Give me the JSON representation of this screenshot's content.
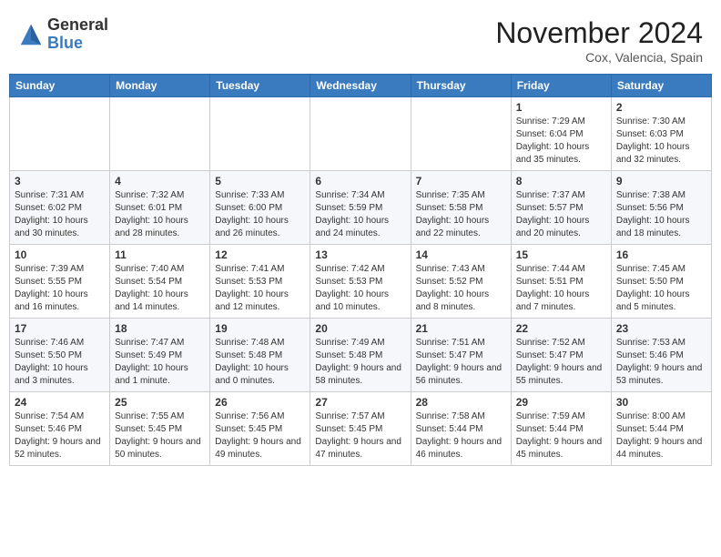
{
  "header": {
    "logo_general": "General",
    "logo_blue": "Blue",
    "month_title": "November 2024",
    "location": "Cox, Valencia, Spain"
  },
  "weekdays": [
    "Sunday",
    "Monday",
    "Tuesday",
    "Wednesday",
    "Thursday",
    "Friday",
    "Saturday"
  ],
  "weeks": [
    [
      {
        "day": "",
        "sunrise": "",
        "sunset": "",
        "daylight": ""
      },
      {
        "day": "",
        "sunrise": "",
        "sunset": "",
        "daylight": ""
      },
      {
        "day": "",
        "sunrise": "",
        "sunset": "",
        "daylight": ""
      },
      {
        "day": "",
        "sunrise": "",
        "sunset": "",
        "daylight": ""
      },
      {
        "day": "",
        "sunrise": "",
        "sunset": "",
        "daylight": ""
      },
      {
        "day": "1",
        "sunrise": "Sunrise: 7:29 AM",
        "sunset": "Sunset: 6:04 PM",
        "daylight": "Daylight: 10 hours and 35 minutes."
      },
      {
        "day": "2",
        "sunrise": "Sunrise: 7:30 AM",
        "sunset": "Sunset: 6:03 PM",
        "daylight": "Daylight: 10 hours and 32 minutes."
      }
    ],
    [
      {
        "day": "3",
        "sunrise": "Sunrise: 7:31 AM",
        "sunset": "Sunset: 6:02 PM",
        "daylight": "Daylight: 10 hours and 30 minutes."
      },
      {
        "day": "4",
        "sunrise": "Sunrise: 7:32 AM",
        "sunset": "Sunset: 6:01 PM",
        "daylight": "Daylight: 10 hours and 28 minutes."
      },
      {
        "day": "5",
        "sunrise": "Sunrise: 7:33 AM",
        "sunset": "Sunset: 6:00 PM",
        "daylight": "Daylight: 10 hours and 26 minutes."
      },
      {
        "day": "6",
        "sunrise": "Sunrise: 7:34 AM",
        "sunset": "Sunset: 5:59 PM",
        "daylight": "Daylight: 10 hours and 24 minutes."
      },
      {
        "day": "7",
        "sunrise": "Sunrise: 7:35 AM",
        "sunset": "Sunset: 5:58 PM",
        "daylight": "Daylight: 10 hours and 22 minutes."
      },
      {
        "day": "8",
        "sunrise": "Sunrise: 7:37 AM",
        "sunset": "Sunset: 5:57 PM",
        "daylight": "Daylight: 10 hours and 20 minutes."
      },
      {
        "day": "9",
        "sunrise": "Sunrise: 7:38 AM",
        "sunset": "Sunset: 5:56 PM",
        "daylight": "Daylight: 10 hours and 18 minutes."
      }
    ],
    [
      {
        "day": "10",
        "sunrise": "Sunrise: 7:39 AM",
        "sunset": "Sunset: 5:55 PM",
        "daylight": "Daylight: 10 hours and 16 minutes."
      },
      {
        "day": "11",
        "sunrise": "Sunrise: 7:40 AM",
        "sunset": "Sunset: 5:54 PM",
        "daylight": "Daylight: 10 hours and 14 minutes."
      },
      {
        "day": "12",
        "sunrise": "Sunrise: 7:41 AM",
        "sunset": "Sunset: 5:53 PM",
        "daylight": "Daylight: 10 hours and 12 minutes."
      },
      {
        "day": "13",
        "sunrise": "Sunrise: 7:42 AM",
        "sunset": "Sunset: 5:53 PM",
        "daylight": "Daylight: 10 hours and 10 minutes."
      },
      {
        "day": "14",
        "sunrise": "Sunrise: 7:43 AM",
        "sunset": "Sunset: 5:52 PM",
        "daylight": "Daylight: 10 hours and 8 minutes."
      },
      {
        "day": "15",
        "sunrise": "Sunrise: 7:44 AM",
        "sunset": "Sunset: 5:51 PM",
        "daylight": "Daylight: 10 hours and 7 minutes."
      },
      {
        "day": "16",
        "sunrise": "Sunrise: 7:45 AM",
        "sunset": "Sunset: 5:50 PM",
        "daylight": "Daylight: 10 hours and 5 minutes."
      }
    ],
    [
      {
        "day": "17",
        "sunrise": "Sunrise: 7:46 AM",
        "sunset": "Sunset: 5:50 PM",
        "daylight": "Daylight: 10 hours and 3 minutes."
      },
      {
        "day": "18",
        "sunrise": "Sunrise: 7:47 AM",
        "sunset": "Sunset: 5:49 PM",
        "daylight": "Daylight: 10 hours and 1 minute."
      },
      {
        "day": "19",
        "sunrise": "Sunrise: 7:48 AM",
        "sunset": "Sunset: 5:48 PM",
        "daylight": "Daylight: 10 hours and 0 minutes."
      },
      {
        "day": "20",
        "sunrise": "Sunrise: 7:49 AM",
        "sunset": "Sunset: 5:48 PM",
        "daylight": "Daylight: 9 hours and 58 minutes."
      },
      {
        "day": "21",
        "sunrise": "Sunrise: 7:51 AM",
        "sunset": "Sunset: 5:47 PM",
        "daylight": "Daylight: 9 hours and 56 minutes."
      },
      {
        "day": "22",
        "sunrise": "Sunrise: 7:52 AM",
        "sunset": "Sunset: 5:47 PM",
        "daylight": "Daylight: 9 hours and 55 minutes."
      },
      {
        "day": "23",
        "sunrise": "Sunrise: 7:53 AM",
        "sunset": "Sunset: 5:46 PM",
        "daylight": "Daylight: 9 hours and 53 minutes."
      }
    ],
    [
      {
        "day": "24",
        "sunrise": "Sunrise: 7:54 AM",
        "sunset": "Sunset: 5:46 PM",
        "daylight": "Daylight: 9 hours and 52 minutes."
      },
      {
        "day": "25",
        "sunrise": "Sunrise: 7:55 AM",
        "sunset": "Sunset: 5:45 PM",
        "daylight": "Daylight: 9 hours and 50 minutes."
      },
      {
        "day": "26",
        "sunrise": "Sunrise: 7:56 AM",
        "sunset": "Sunset: 5:45 PM",
        "daylight": "Daylight: 9 hours and 49 minutes."
      },
      {
        "day": "27",
        "sunrise": "Sunrise: 7:57 AM",
        "sunset": "Sunset: 5:45 PM",
        "daylight": "Daylight: 9 hours and 47 minutes."
      },
      {
        "day": "28",
        "sunrise": "Sunrise: 7:58 AM",
        "sunset": "Sunset: 5:44 PM",
        "daylight": "Daylight: 9 hours and 46 minutes."
      },
      {
        "day": "29",
        "sunrise": "Sunrise: 7:59 AM",
        "sunset": "Sunset: 5:44 PM",
        "daylight": "Daylight: 9 hours and 45 minutes."
      },
      {
        "day": "30",
        "sunrise": "Sunrise: 8:00 AM",
        "sunset": "Sunset: 5:44 PM",
        "daylight": "Daylight: 9 hours and 44 minutes."
      }
    ]
  ]
}
